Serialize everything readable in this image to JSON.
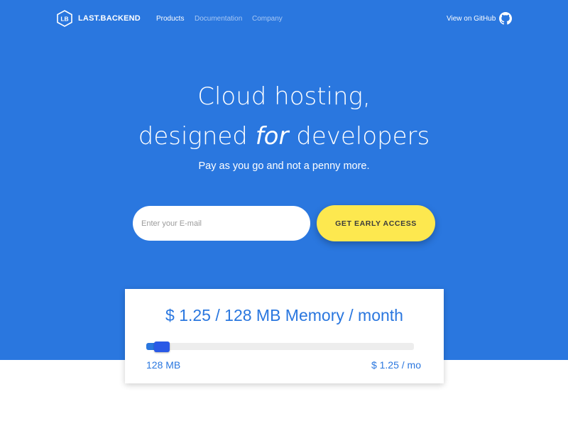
{
  "colors": {
    "hero_bg": "#2a77df",
    "accent": "#2a77df",
    "cta": "#fde84f",
    "nav_inactive": "#a9c8f3",
    "slider_handle": "#2a59e6"
  },
  "nav": {
    "logo_text": "LB",
    "brand": "LAST.BACKEND",
    "links": [
      {
        "label": "Products",
        "active": true
      },
      {
        "label": "Documentation",
        "active": false
      },
      {
        "label": "Company",
        "active": false
      }
    ],
    "github_label": "View on GitHub",
    "github_icon": "github-icon"
  },
  "hero": {
    "headline_line1": "Cloud hosting,",
    "headline_line2_before": "designed",
    "headline_line2_em": "for",
    "headline_line2_after": "developers",
    "subtitle": "Pay as you go and not a penny more."
  },
  "form": {
    "email_placeholder": "Enter your E-mail",
    "email_value": "",
    "cta_label": "GET EARLY ACCESS"
  },
  "pricing": {
    "title": "$ 1.25 / 128 MB Memory / month",
    "slider_level": 0.03,
    "slider_min_label": "128 MB",
    "slider_price_label": "$ 1.25 / mo"
  }
}
